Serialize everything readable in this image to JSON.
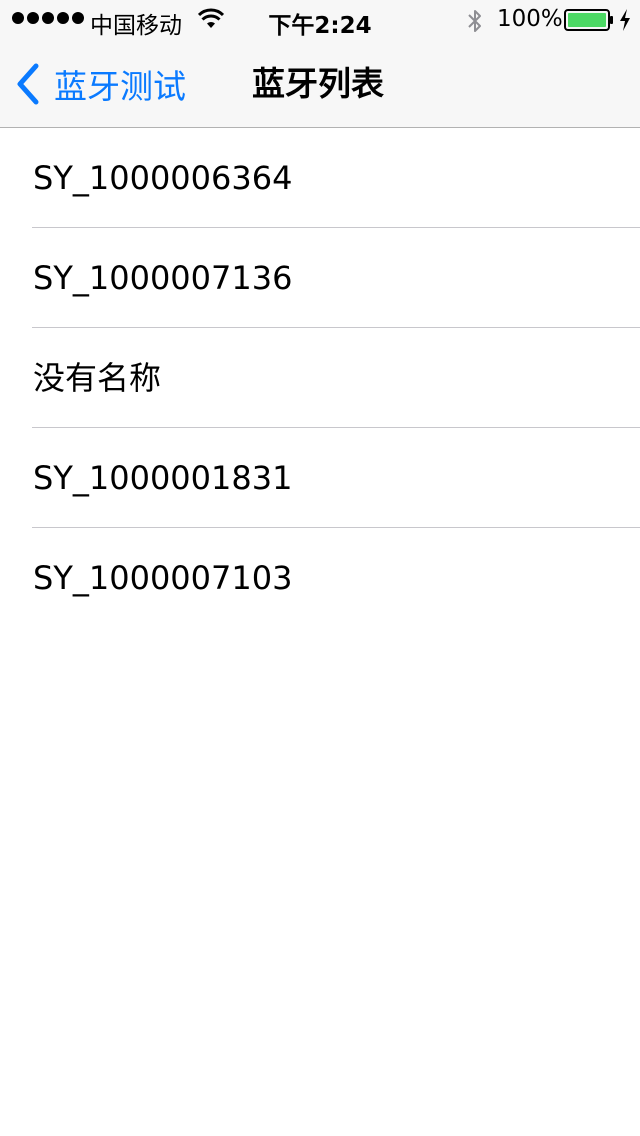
{
  "status_bar": {
    "carrier": "中国移动",
    "time": "下午2:24",
    "battery_percent": "100%",
    "icons": [
      "signal-dots",
      "wifi-icon",
      "bluetooth-icon",
      "battery-icon",
      "charging-icon"
    ]
  },
  "nav": {
    "back_label": "蓝牙测试",
    "title": "蓝牙列表"
  },
  "colors": {
    "accent": "#0a7aff",
    "battery_fill": "#4cd964",
    "separator": "#c8c7cc",
    "bar_background": "#f7f7f7"
  },
  "list": {
    "items": [
      {
        "label": "SY_1000006364"
      },
      {
        "label": "SY_1000007136"
      },
      {
        "label": "没有名称"
      },
      {
        "label": "SY_1000001831"
      },
      {
        "label": "SY_1000007103"
      }
    ]
  }
}
